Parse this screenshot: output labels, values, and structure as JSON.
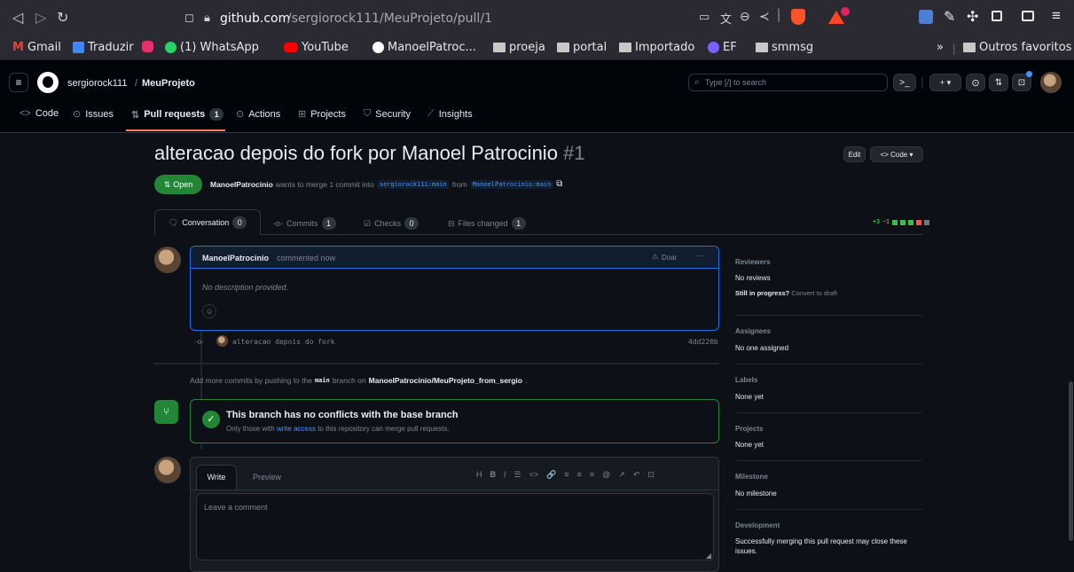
{
  "browser": {
    "url_host": "github.com",
    "url_path": "/sergiorock111/MeuProjeto/pull/1",
    "bookmarks": [
      {
        "label": "Gmail",
        "color": "#ea4335"
      },
      {
        "label": "Traduzir",
        "color": "#4285f4"
      },
      {
        "label": "",
        "color": "#e1306c"
      },
      {
        "label": "(1) WhatsApp",
        "color": "#25d366"
      },
      {
        "label": "YouTube",
        "color": "#ff0000"
      },
      {
        "label": "ManoelPatroc...",
        "color": "#ffffff"
      },
      {
        "label": "proeja",
        "color": "#c8c8c8"
      },
      {
        "label": "portal",
        "color": "#c8c8c8"
      },
      {
        "label": "Importado",
        "color": "#c8c8c8"
      },
      {
        "label": "EF",
        "color": "#7b61ff"
      },
      {
        "label": "smmsg",
        "color": "#c8c8c8"
      }
    ],
    "more_label": "»",
    "other_favorites": "Outros favoritos"
  },
  "header": {
    "owner": "sergiorock111",
    "separator": "/",
    "repo": "MeuProjeto",
    "search_placeholder": "Type [/] to search",
    "plus_label": "+ ▾"
  },
  "repo_tabs": {
    "code": "Code",
    "issues": "Issues",
    "pulls": "Pull requests",
    "pulls_count": "1",
    "actions": "Actions",
    "projects": "Projects",
    "security": "Security",
    "insights": "Insights"
  },
  "pr": {
    "title": "alteracao depois do fork por Manoel Patrocinio",
    "number": "#1",
    "edit_label": "Edit",
    "code_label": "<> Code ▾",
    "status": "Open",
    "author": "ManoelPatrocinio",
    "merge_text": "wants to merge 1 commit into",
    "base_branch": "sergiorock111:main",
    "from_text": "from",
    "head_branch": "ManoelPatrocinio:main"
  },
  "pr_tabs": {
    "conversation": "Conversation",
    "conversation_count": "0",
    "commits": "Commits",
    "commits_count": "1",
    "checks": "Checks",
    "checks_count": "0",
    "files": "Files changed",
    "files_count": "1",
    "additions": "+3",
    "deletions": "−1"
  },
  "comment": {
    "author": "ManoelPatrocinio",
    "meta": "commented now",
    "donate": "Doar",
    "more": "···",
    "body": "No description provided."
  },
  "commit": {
    "message": "alteracao depois do fork",
    "sha": "4dd220b"
  },
  "push_hint": {
    "prefix": "Add more commits by pushing to the",
    "branch": "main",
    "middle": "branch on",
    "repo": "ManoelPatrocinio/MeuProjeto_from_sergio",
    "suffix": "."
  },
  "merge_box": {
    "title": "This branch has no conflicts with the base branch",
    "sub_prefix": "Only those with",
    "sub_link": "write access",
    "sub_suffix": "to this repository can merge pull requests."
  },
  "editor": {
    "write_tab": "Write",
    "preview_tab": "Preview",
    "placeholder": "Leave a comment",
    "toolbar": [
      "H",
      "B",
      "I",
      "☰",
      "<>",
      "🔗",
      "≡",
      "≡",
      "≡",
      "@",
      "↗",
      "↶",
      "⊡"
    ]
  },
  "sidebar": {
    "reviewers_h": "Reviewers",
    "reviewers_v": "No reviews",
    "still_progress": "Still in progress?",
    "convert_draft": "Convert to draft",
    "assignees_h": "Assignees",
    "assignees_v": "No one assigned",
    "labels_h": "Labels",
    "labels_v": "None yet",
    "projects_h": "Projects",
    "projects_v": "None yet",
    "milestone_h": "Milestone",
    "milestone_v": "No milestone",
    "development_h": "Development",
    "development_v": "Successfully merging this pull request may close these issues."
  },
  "colors": {
    "accent_green": "#238636",
    "link_blue": "#4493f8",
    "bg": "#0d1117",
    "addition": "#3fb950",
    "deletion": "#f85149"
  }
}
